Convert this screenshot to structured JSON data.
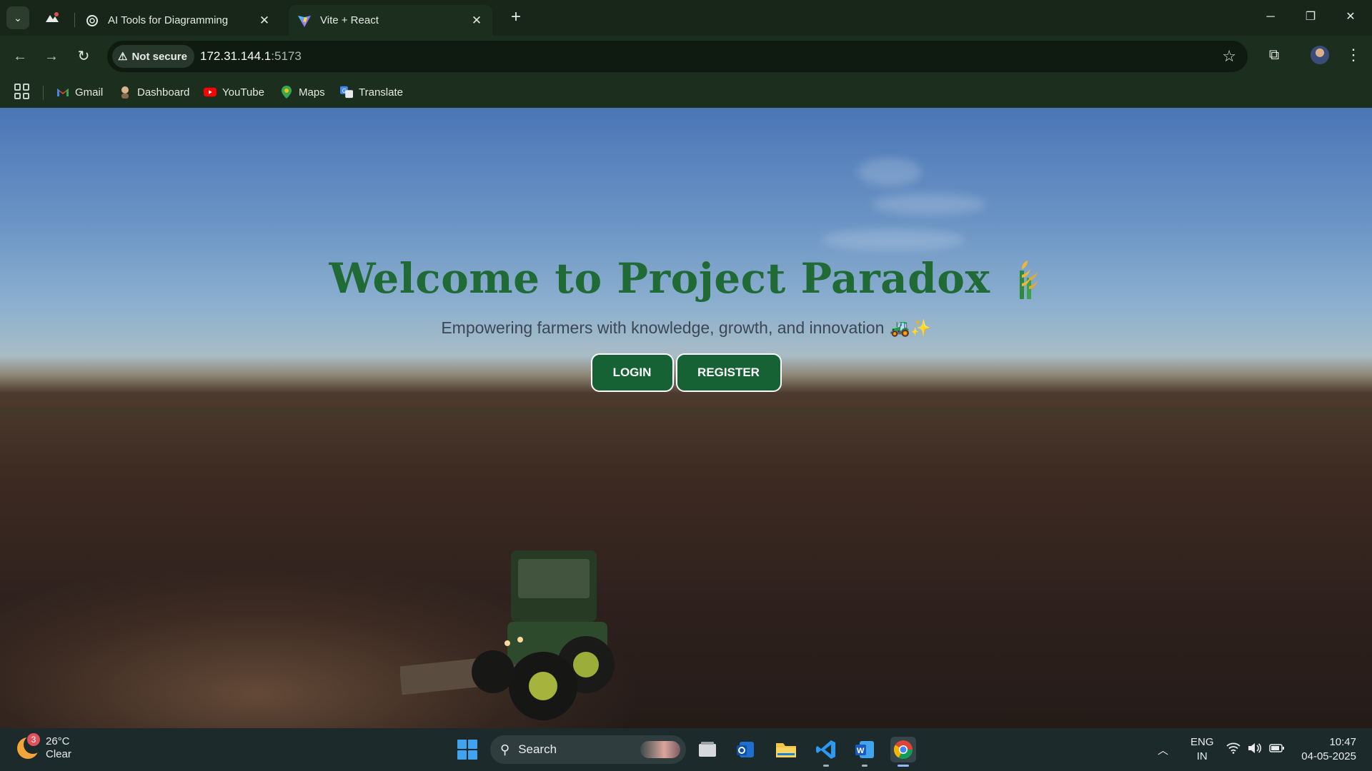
{
  "browser": {
    "tabs": [
      {
        "title": "AI Tools for Diagramming",
        "active": false,
        "favicon": "openai-icon"
      },
      {
        "title": "Vite + React",
        "active": true,
        "favicon": "vite-icon"
      }
    ],
    "security_label": "Not secure",
    "url_host": "172.31.144.1",
    "url_port": ":5173",
    "bookmarks": [
      {
        "label": "Gmail",
        "icon": "gmail-icon"
      },
      {
        "label": "Dashboard",
        "icon": "dashboard-icon"
      },
      {
        "label": "YouTube",
        "icon": "youtube-icon"
      },
      {
        "label": "Maps",
        "icon": "maps-icon"
      },
      {
        "label": "Translate",
        "icon": "translate-icon"
      }
    ]
  },
  "hero": {
    "title": "Welcome to Project Paradox",
    "subtitle": "Empowering farmers with knowledge, growth, and innovation",
    "subtitle_emoji": "🚜✨",
    "login_label": "LOGIN",
    "register_label": "REGISTER",
    "title_color": "#1f6a35",
    "button_color": "#176234"
  },
  "taskbar": {
    "weather_badge": "3",
    "temperature": "26°C",
    "condition": "Clear",
    "search_placeholder": "Search",
    "language": "ENG",
    "region": "IN",
    "time": "10:47",
    "date": "04-05-2025",
    "apps": [
      "file-explorer-icon",
      "outlook-icon",
      "folder-icon",
      "vscode-icon",
      "word-icon",
      "chrome-icon"
    ]
  }
}
